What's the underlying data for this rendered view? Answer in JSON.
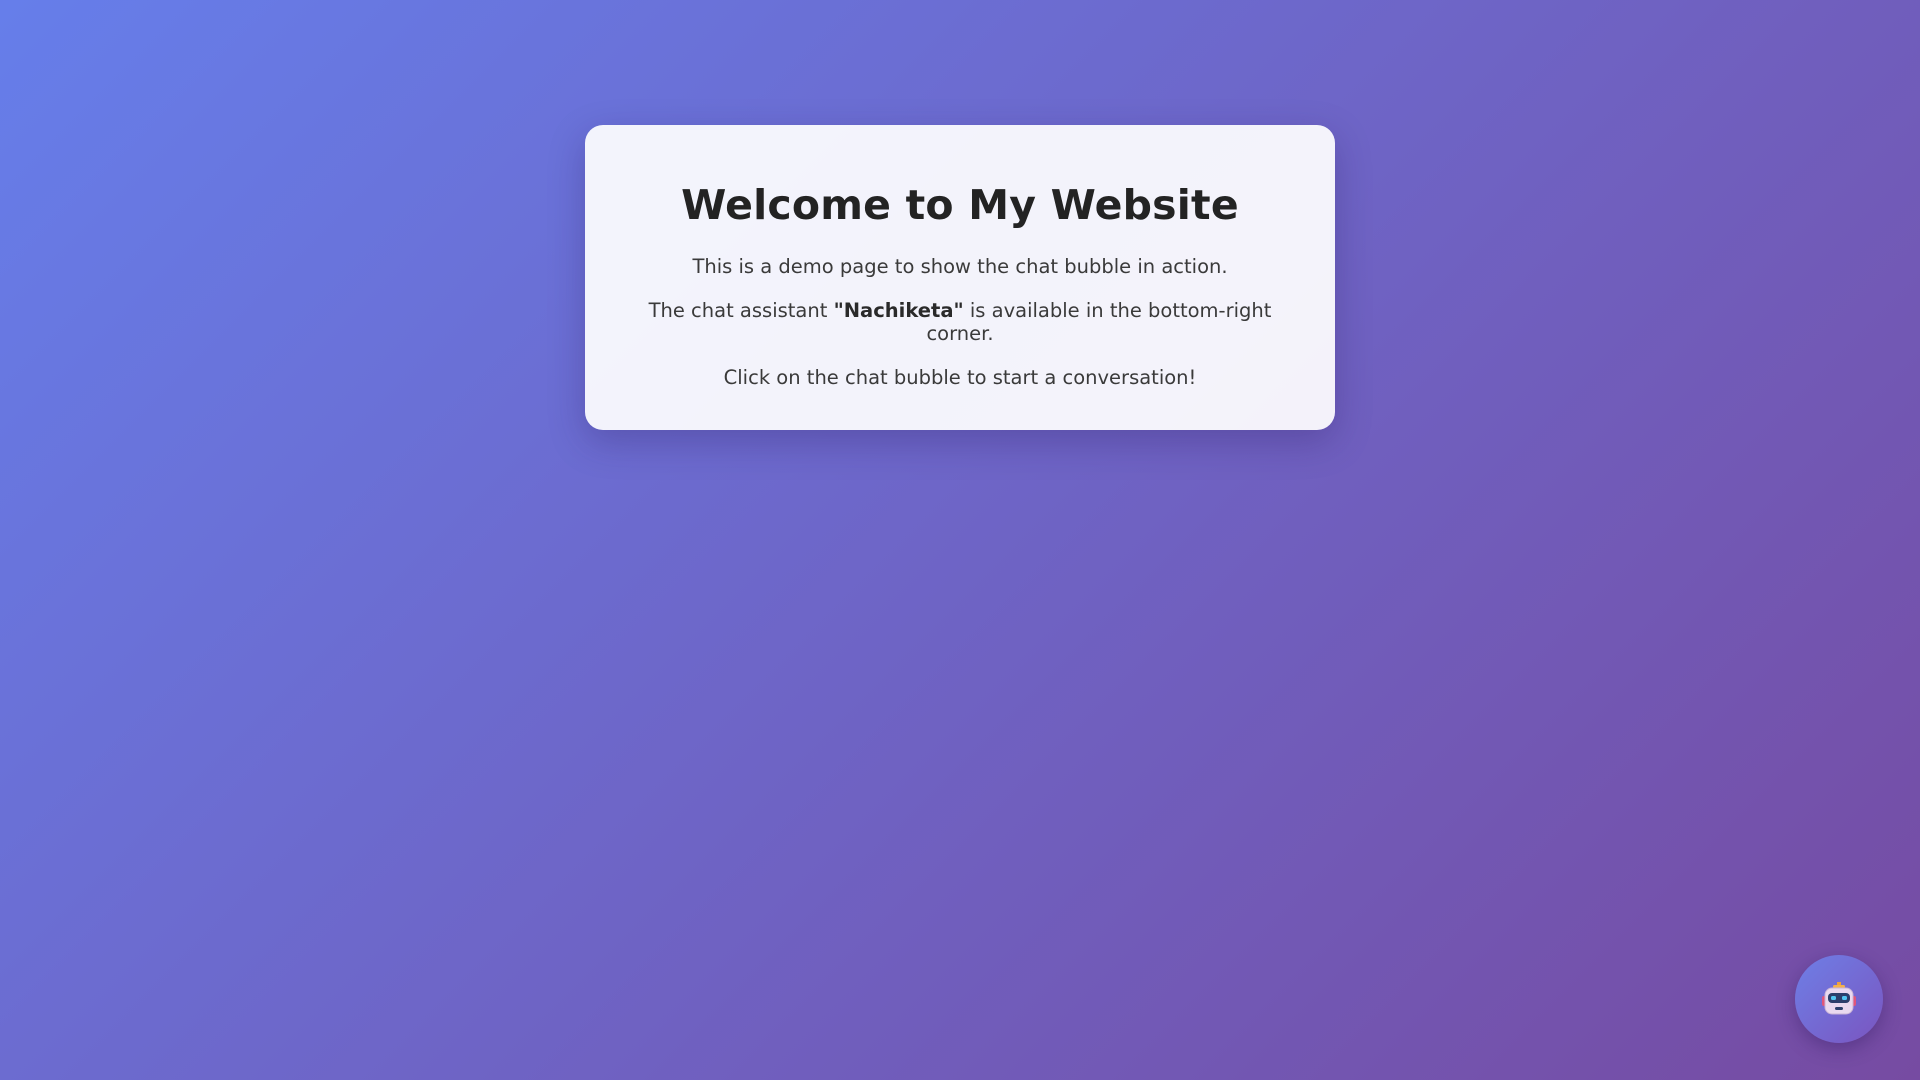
{
  "main": {
    "title": "Welcome to My Website",
    "line1": "This is a demo page to show the chat bubble in action.",
    "line2_before": "The chat assistant ",
    "line2_bold": "\"Nachiketa\"",
    "line2_after": " is available in the bottom-right corner.",
    "line3": "Click on the chat bubble to start a conversation!"
  },
  "chat_bubble": {
    "icon": "robot-icon"
  },
  "colors": {
    "gradient_start": "#667eea",
    "gradient_end": "#764ba2",
    "card_background": "#f2f1f8",
    "title_text": "#232323"
  }
}
